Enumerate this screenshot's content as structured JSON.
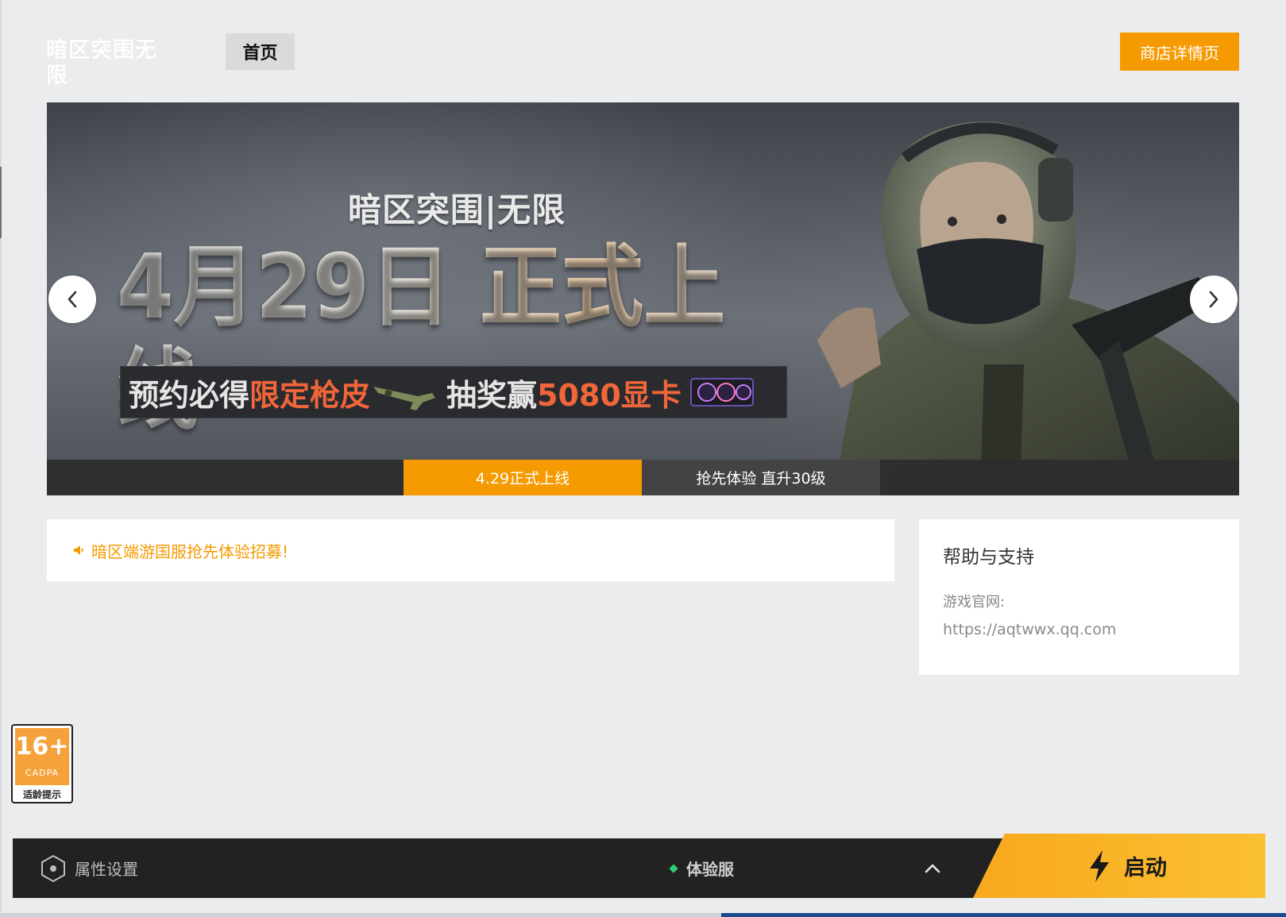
{
  "header": {
    "logo_text": "暗区突围无限",
    "nav_home": "首页",
    "store_button": "商店详情页"
  },
  "banner": {
    "game_title": "暗区突围|无限",
    "headline": "4月29日 正式上线",
    "promo": {
      "part1": "预约必得",
      "part1_accent": "限定枪皮",
      "part2": "抽奖赢",
      "part2_accent": "5080显卡"
    },
    "tabs": [
      {
        "label": "4.29正式上线",
        "active": true
      },
      {
        "label": "抢先体验 直升30级",
        "active": false
      }
    ],
    "prev_icon": "chevron-left-icon",
    "next_icon": "chevron-right-icon"
  },
  "announcement": {
    "icon": "speaker-icon",
    "text": "暗区端游国服抢先体验招募!"
  },
  "help": {
    "title": "帮助与支持",
    "site_label": "游戏官网:",
    "site_url": "https://aqtwwx.qq.com"
  },
  "age_rating": {
    "age": "16+",
    "org": "CADPA",
    "tip": "适龄提示"
  },
  "bottom_bar": {
    "settings_label": "属性设置",
    "server_label": "体验服",
    "server_status_color": "#2ecc71",
    "launch_label": "启动"
  },
  "colors": {
    "accent": "#f59a00",
    "bottom_bar_bg": "#222222",
    "launch_gradient_start": "#f8a81c",
    "launch_gradient_end": "#fbc034"
  }
}
